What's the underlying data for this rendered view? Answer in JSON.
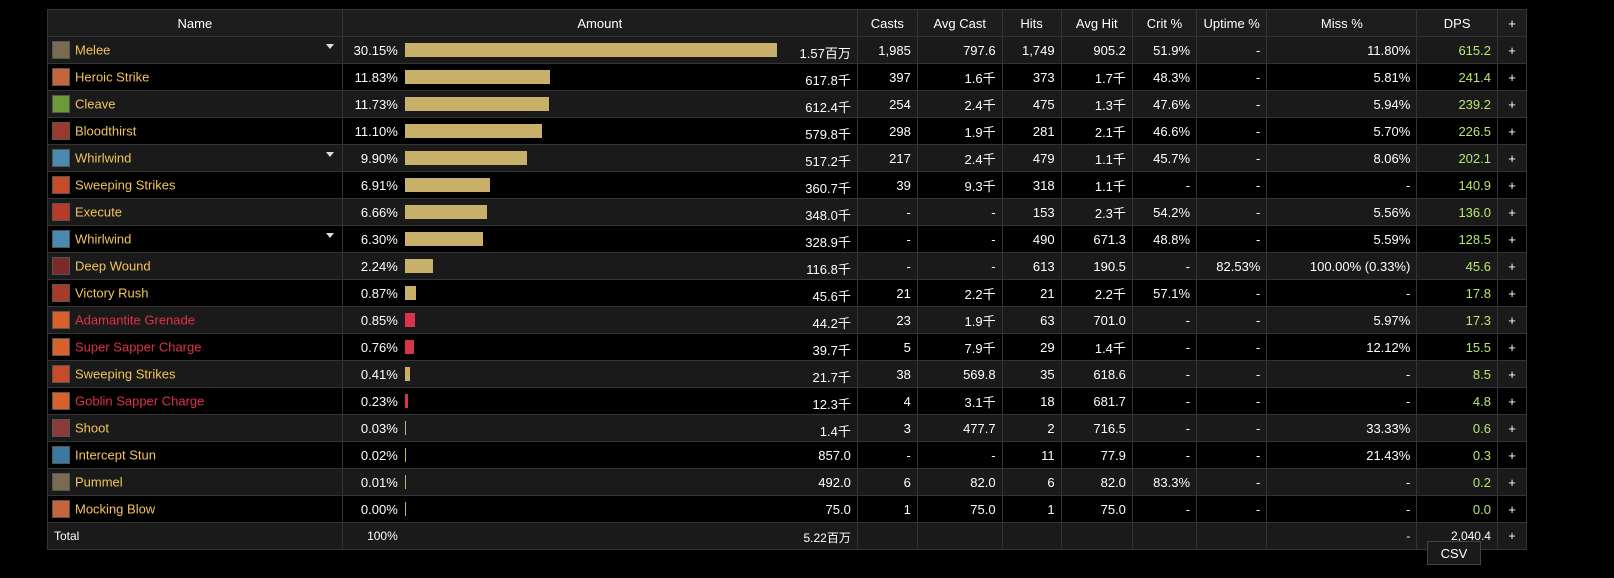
{
  "headers": {
    "name": "Name",
    "amount": "Amount",
    "casts": "Casts",
    "avg_cast": "Avg Cast",
    "hits": "Hits",
    "avg_hit": "Avg Hit",
    "crit": "Crit %",
    "uptime": "Uptime %",
    "miss": "Miss %",
    "dps": "DPS",
    "plus": "+"
  },
  "rows": [
    {
      "icon": "melee-icon",
      "color": "#7a6a50",
      "name": "Melee",
      "caret": true,
      "red": false,
      "pct": "30.15%",
      "bar": 1.0,
      "amount": "1.57百万",
      "casts": "1,985",
      "avg_cast": "797.6",
      "hits": "1,749",
      "avg_hit": "905.2",
      "crit": "51.9%",
      "uptime": "-",
      "miss": "11.80%",
      "dps": "615.2"
    },
    {
      "icon": "heroic-strike-icon",
      "color": "#c8643a",
      "name": "Heroic Strike",
      "caret": false,
      "red": false,
      "pct": "11.83%",
      "bar": 0.39,
      "amount": "617.8千",
      "casts": "397",
      "avg_cast": "1.6千",
      "hits": "373",
      "avg_hit": "1.7千",
      "crit": "48.3%",
      "uptime": "-",
      "miss": "5.81%",
      "dps": "241.4"
    },
    {
      "icon": "cleave-icon",
      "color": "#6a9a3a",
      "name": "Cleave",
      "caret": false,
      "red": false,
      "pct": "11.73%",
      "bar": 0.388,
      "amount": "612.4千",
      "casts": "254",
      "avg_cast": "2.4千",
      "hits": "475",
      "avg_hit": "1.3千",
      "crit": "47.6%",
      "uptime": "-",
      "miss": "5.94%",
      "dps": "239.2"
    },
    {
      "icon": "bloodthirst-icon",
      "color": "#9a3a2a",
      "name": "Bloodthirst",
      "caret": false,
      "red": false,
      "pct": "11.10%",
      "bar": 0.368,
      "amount": "579.8千",
      "casts": "298",
      "avg_cast": "1.9千",
      "hits": "281",
      "avg_hit": "2.1千",
      "crit": "46.6%",
      "uptime": "-",
      "miss": "5.70%",
      "dps": "226.5"
    },
    {
      "icon": "whirlwind-icon",
      "color": "#4a8ab0",
      "name": "Whirlwind",
      "caret": true,
      "red": false,
      "pct": "9.90%",
      "bar": 0.328,
      "amount": "517.2千",
      "casts": "217",
      "avg_cast": "2.4千",
      "hits": "479",
      "avg_hit": "1.1千",
      "crit": "45.7%",
      "uptime": "-",
      "miss": "8.06%",
      "dps": "202.1"
    },
    {
      "icon": "sweeping-strikes-icon",
      "color": "#c84a2a",
      "name": "Sweeping Strikes",
      "caret": false,
      "red": false,
      "pct": "6.91%",
      "bar": 0.229,
      "amount": "360.7千",
      "casts": "39",
      "avg_cast": "9.3千",
      "hits": "318",
      "avg_hit": "1.1千",
      "crit": "-",
      "uptime": "-",
      "miss": "-",
      "dps": "140.9"
    },
    {
      "icon": "execute-icon",
      "color": "#b83a2a",
      "name": "Execute",
      "caret": false,
      "red": false,
      "pct": "6.66%",
      "bar": 0.221,
      "amount": "348.0千",
      "casts": "-",
      "avg_cast": "-",
      "hits": "153",
      "avg_hit": "2.3千",
      "crit": "54.2%",
      "uptime": "-",
      "miss": "5.56%",
      "dps": "136.0"
    },
    {
      "icon": "whirlwind-icon",
      "color": "#4a8ab0",
      "name": "Whirlwind",
      "caret": true,
      "red": false,
      "pct": "6.30%",
      "bar": 0.209,
      "amount": "328.9千",
      "casts": "-",
      "avg_cast": "-",
      "hits": "490",
      "avg_hit": "671.3",
      "crit": "48.8%",
      "uptime": "-",
      "miss": "5.59%",
      "dps": "128.5"
    },
    {
      "icon": "deep-wound-icon",
      "color": "#7a2a2a",
      "name": "Deep Wound",
      "caret": false,
      "red": false,
      "pct": "2.24%",
      "bar": 0.074,
      "amount": "116.8千",
      "casts": "-",
      "avg_cast": "-",
      "hits": "613",
      "avg_hit": "190.5",
      "crit": "-",
      "uptime": "82.53%",
      "miss": "100.00% (0.33%)",
      "dps": "45.6"
    },
    {
      "icon": "victory-rush-icon",
      "color": "#a83a2a",
      "name": "Victory Rush",
      "caret": false,
      "red": false,
      "pct": "0.87%",
      "bar": 0.029,
      "amount": "45.6千",
      "casts": "21",
      "avg_cast": "2.2千",
      "hits": "21",
      "avg_hit": "2.2千",
      "crit": "57.1%",
      "uptime": "-",
      "miss": "-",
      "dps": "17.8"
    },
    {
      "icon": "adamantite-grenade-icon",
      "color": "#d8602a",
      "name": "Adamantite Grenade",
      "caret": false,
      "red": true,
      "pct": "0.85%",
      "bar": 0.028,
      "amount": "44.2千",
      "casts": "23",
      "avg_cast": "1.9千",
      "hits": "63",
      "avg_hit": "701.0",
      "crit": "-",
      "uptime": "-",
      "miss": "5.97%",
      "dps": "17.3"
    },
    {
      "icon": "super-sapper-charge-icon",
      "color": "#d8602a",
      "name": "Super Sapper Charge",
      "caret": false,
      "red": true,
      "pct": "0.76%",
      "bar": 0.025,
      "amount": "39.7千",
      "casts": "5",
      "avg_cast": "7.9千",
      "hits": "29",
      "avg_hit": "1.4千",
      "crit": "-",
      "uptime": "-",
      "miss": "12.12%",
      "dps": "15.5"
    },
    {
      "icon": "sweeping-strikes-icon",
      "color": "#c84a2a",
      "name": "Sweeping Strikes",
      "caret": false,
      "red": false,
      "pct": "0.41%",
      "bar": 0.014,
      "amount": "21.7千",
      "casts": "38",
      "avg_cast": "569.8",
      "hits": "35",
      "avg_hit": "618.6",
      "crit": "-",
      "uptime": "-",
      "miss": "-",
      "dps": "8.5"
    },
    {
      "icon": "goblin-sapper-charge-icon",
      "color": "#d8602a",
      "name": "Goblin Sapper Charge",
      "caret": false,
      "red": true,
      "pct": "0.23%",
      "bar": 0.008,
      "amount": "12.3千",
      "casts": "4",
      "avg_cast": "3.1千",
      "hits": "18",
      "avg_hit": "681.7",
      "crit": "-",
      "uptime": "-",
      "miss": "-",
      "dps": "4.8"
    },
    {
      "icon": "shoot-icon",
      "color": "#8a3a3a",
      "name": "Shoot",
      "caret": false,
      "red": false,
      "pct": "0.03%",
      "bar": 0.001,
      "amount": "1.4千",
      "casts": "3",
      "avg_cast": "477.7",
      "hits": "2",
      "avg_hit": "716.5",
      "crit": "-",
      "uptime": "-",
      "miss": "33.33%",
      "dps": "0.6"
    },
    {
      "icon": "intercept-stun-icon",
      "color": "#3a7aa0",
      "name": "Intercept Stun",
      "caret": false,
      "red": false,
      "pct": "0.02%",
      "bar": 0.0005,
      "amount": "857.0",
      "casts": "-",
      "avg_cast": "-",
      "hits": "11",
      "avg_hit": "77.9",
      "crit": "-",
      "uptime": "-",
      "miss": "21.43%",
      "dps": "0.3"
    },
    {
      "icon": "pummel-icon",
      "color": "#7a6a50",
      "name": "Pummel",
      "caret": false,
      "red": false,
      "pct": "0.01%",
      "bar": 0.0003,
      "amount": "492.0",
      "casts": "6",
      "avg_cast": "82.0",
      "hits": "6",
      "avg_hit": "82.0",
      "crit": "83.3%",
      "uptime": "-",
      "miss": "-",
      "dps": "0.2"
    },
    {
      "icon": "mocking-blow-icon",
      "color": "#c8643a",
      "name": "Mocking Blow",
      "caret": false,
      "red": false,
      "pct": "0.00%",
      "bar": 0.0001,
      "amount": "75.0",
      "casts": "1",
      "avg_cast": "75.0",
      "hits": "1",
      "avg_hit": "75.0",
      "crit": "-",
      "uptime": "-",
      "miss": "-",
      "dps": "0.0"
    }
  ],
  "total": {
    "label": "Total",
    "pct": "100%",
    "amount": "5.22百万",
    "miss": "-",
    "dps": "2,040.4"
  },
  "csv_label": "CSV"
}
